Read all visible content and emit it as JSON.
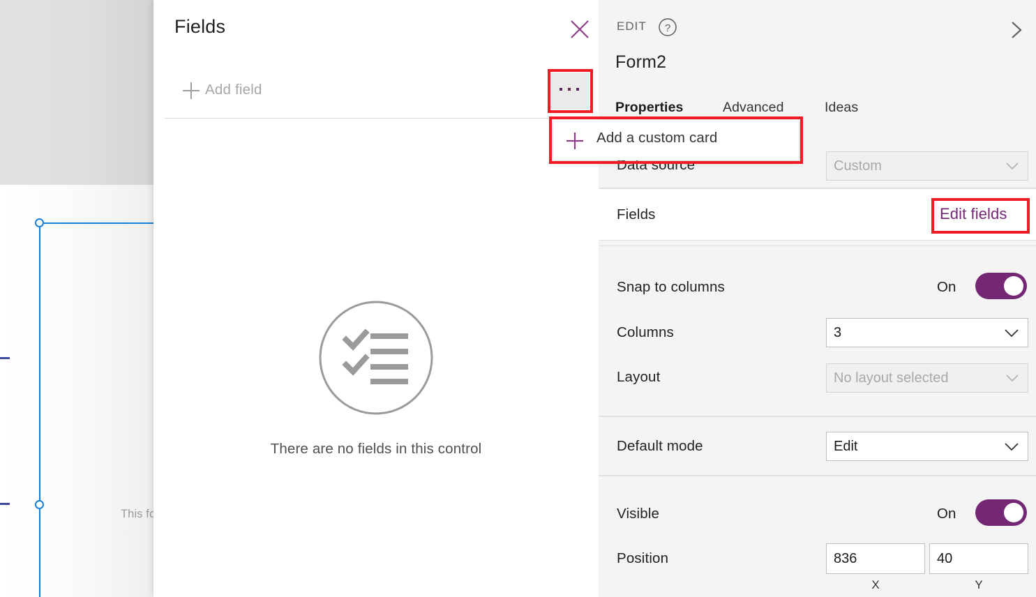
{
  "canvas": {
    "form_hint_text": "This fo",
    "selection_color": "#1a7fd4"
  },
  "fields_panel": {
    "title": "Fields",
    "close_icon": "close-icon",
    "add_field_label": "Add field",
    "add_field_icon": "plus-icon",
    "more_icon": "ellipsis-icon",
    "empty_state": {
      "icon": "checklist-icon",
      "text": "There are no fields in this control"
    }
  },
  "context_menu": {
    "items": [
      {
        "label": "Add a custom card",
        "icon": "plus-icon"
      }
    ]
  },
  "properties_panel": {
    "eyebrow": "EDIT",
    "help_icon": "help-circle-icon",
    "collapse_icon": "chevron-right-icon",
    "control_name": "Form2",
    "tabs": [
      {
        "label": "Properties",
        "active": true
      },
      {
        "label": "Advanced",
        "active": false
      },
      {
        "label": "Ideas",
        "active": false
      }
    ],
    "rows": {
      "data_source": {
        "label": "Data source",
        "value": "Custom",
        "disabled": true
      },
      "fields": {
        "label": "Fields",
        "action_label": "Edit fields"
      },
      "snap_to_columns": {
        "label": "Snap to columns",
        "state_label": "On"
      },
      "columns": {
        "label": "Columns",
        "value": "3"
      },
      "layout": {
        "label": "Layout",
        "value": "No layout selected",
        "disabled": true
      },
      "default_mode": {
        "label": "Default mode",
        "value": "Edit"
      },
      "visible": {
        "label": "Visible",
        "state_label": "On"
      },
      "position": {
        "label": "Position",
        "x_value": "836",
        "y_value": "40",
        "x_caption": "X",
        "y_caption": "Y"
      }
    }
  },
  "colors": {
    "accent_purple": "#742774",
    "annotation_red": "#ee1c25",
    "panel_bg": "#f4f4f4",
    "selection_blue": "#1a7fd4"
  }
}
